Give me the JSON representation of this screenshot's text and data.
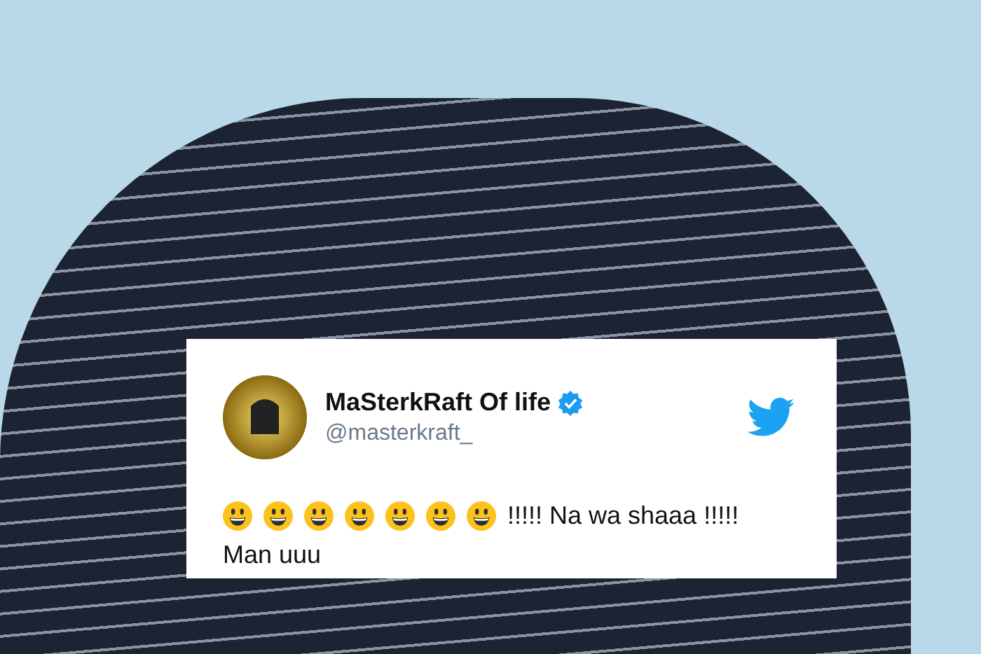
{
  "tweet": {
    "display_name": "MaSterkRaft Of life",
    "verified": true,
    "handle": "@masterkraft_",
    "emojis": [
      {
        "kind": "grinning"
      },
      {
        "kind": "grinning"
      },
      {
        "kind": "grinning"
      },
      {
        "kind": "grinning"
      },
      {
        "kind": "grinning"
      },
      {
        "kind": "grinning"
      },
      {
        "kind": "grinning"
      }
    ],
    "text_lines": [
      "!!!!! Na wa shaaa !!!!!",
      "Man uuu"
    ]
  }
}
